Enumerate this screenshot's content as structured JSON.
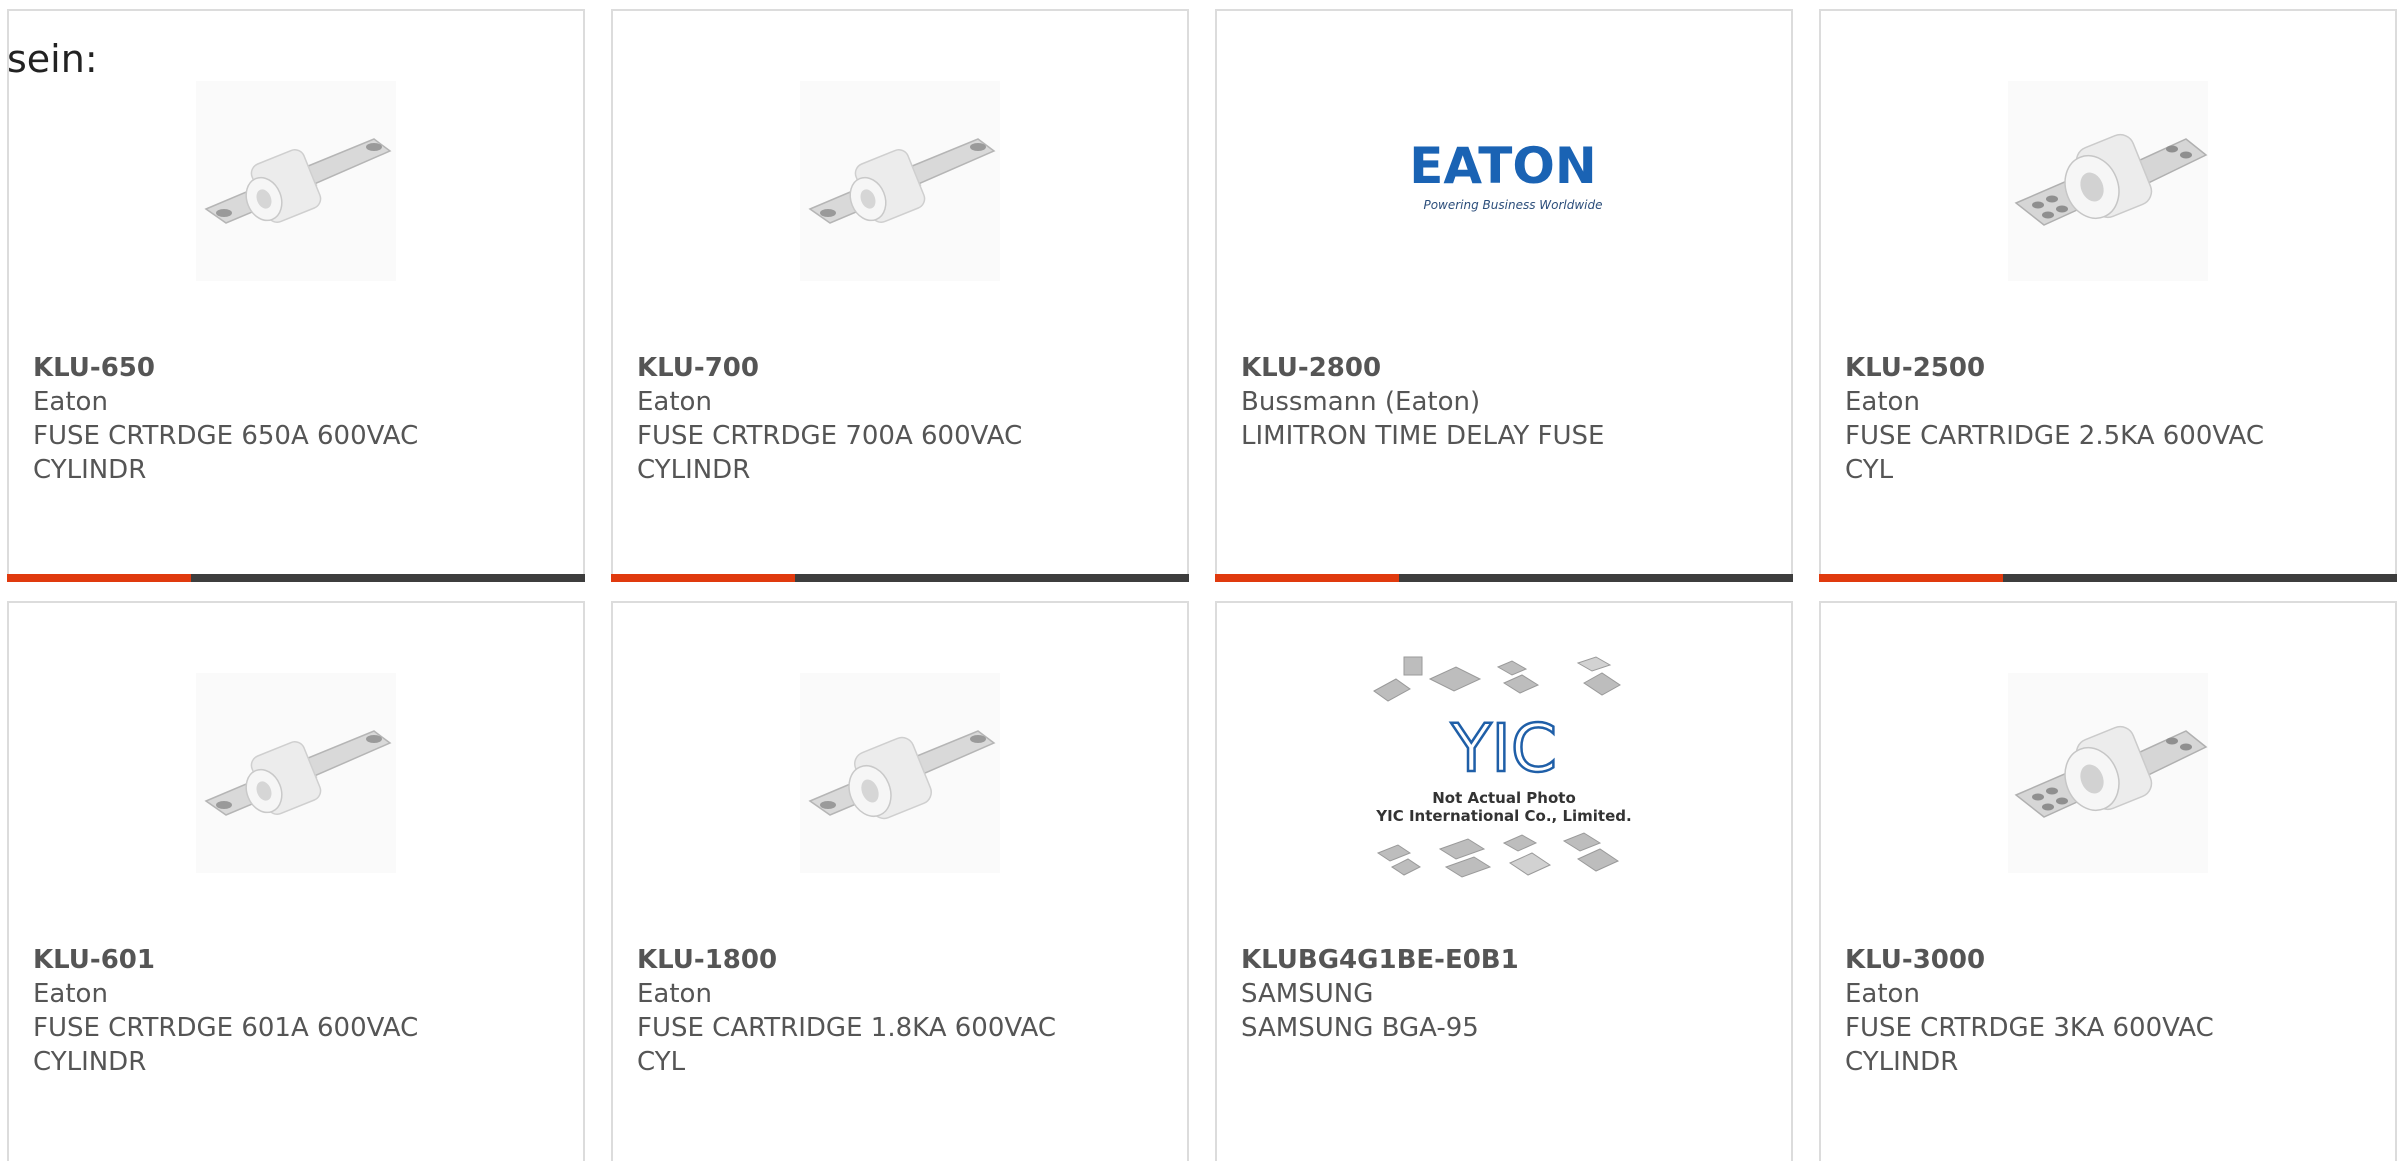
{
  "leading_text": "sein:",
  "colors": {
    "accent": "#e03a0e",
    "bar": "#3d3d3d",
    "border": "#dcdcdc",
    "text": "#555555"
  },
  "products": [
    {
      "part_number": "KLU-650",
      "manufacturer": "Eaton",
      "description": "FUSE CRTRDGE 650A 600VAC CYLINDR",
      "image": "fuse-2hole-icon"
    },
    {
      "part_number": "KLU-700",
      "manufacturer": "Eaton",
      "description": "FUSE CRTRDGE 700A 600VAC CYLINDR",
      "image": "fuse-2hole-icon"
    },
    {
      "part_number": "KLU-2800",
      "manufacturer": "Bussmann (Eaton)",
      "description": "LIMITRON TIME DELAY FUSE",
      "image": "eaton-logo",
      "logo_text": "EATON",
      "logo_tagline": "Powering Business Worldwide"
    },
    {
      "part_number": "KLU-2500",
      "manufacturer": "Eaton",
      "description": "FUSE CARTRIDGE 2.5KA 600VAC CYL",
      "image": "fuse-4hole-icon"
    },
    {
      "part_number": "KLU-601",
      "manufacturer": "Eaton",
      "description": "FUSE CRTRDGE 601A 600VAC CYLINDR",
      "image": "fuse-2hole-icon"
    },
    {
      "part_number": "KLU-1800",
      "manufacturer": "Eaton",
      "description": "FUSE CARTRIDGE 1.8KA 600VAC CYL",
      "image": "fuse-2hole-icon"
    },
    {
      "part_number": "KLUBG4G1BE-E0B1",
      "manufacturer": "SAMSUNG",
      "description": "SAMSUNG BGA-95",
      "image": "yic-placeholder",
      "logo_text": "YIC",
      "photo_note_1": "Not Actual Photo",
      "photo_note_2": "YIC International Co., Limited."
    },
    {
      "part_number": "KLU-3000",
      "manufacturer": "Eaton",
      "description": "FUSE CRTRDGE 3KA 600VAC CYLINDR",
      "image": "fuse-4hole-icon"
    }
  ]
}
